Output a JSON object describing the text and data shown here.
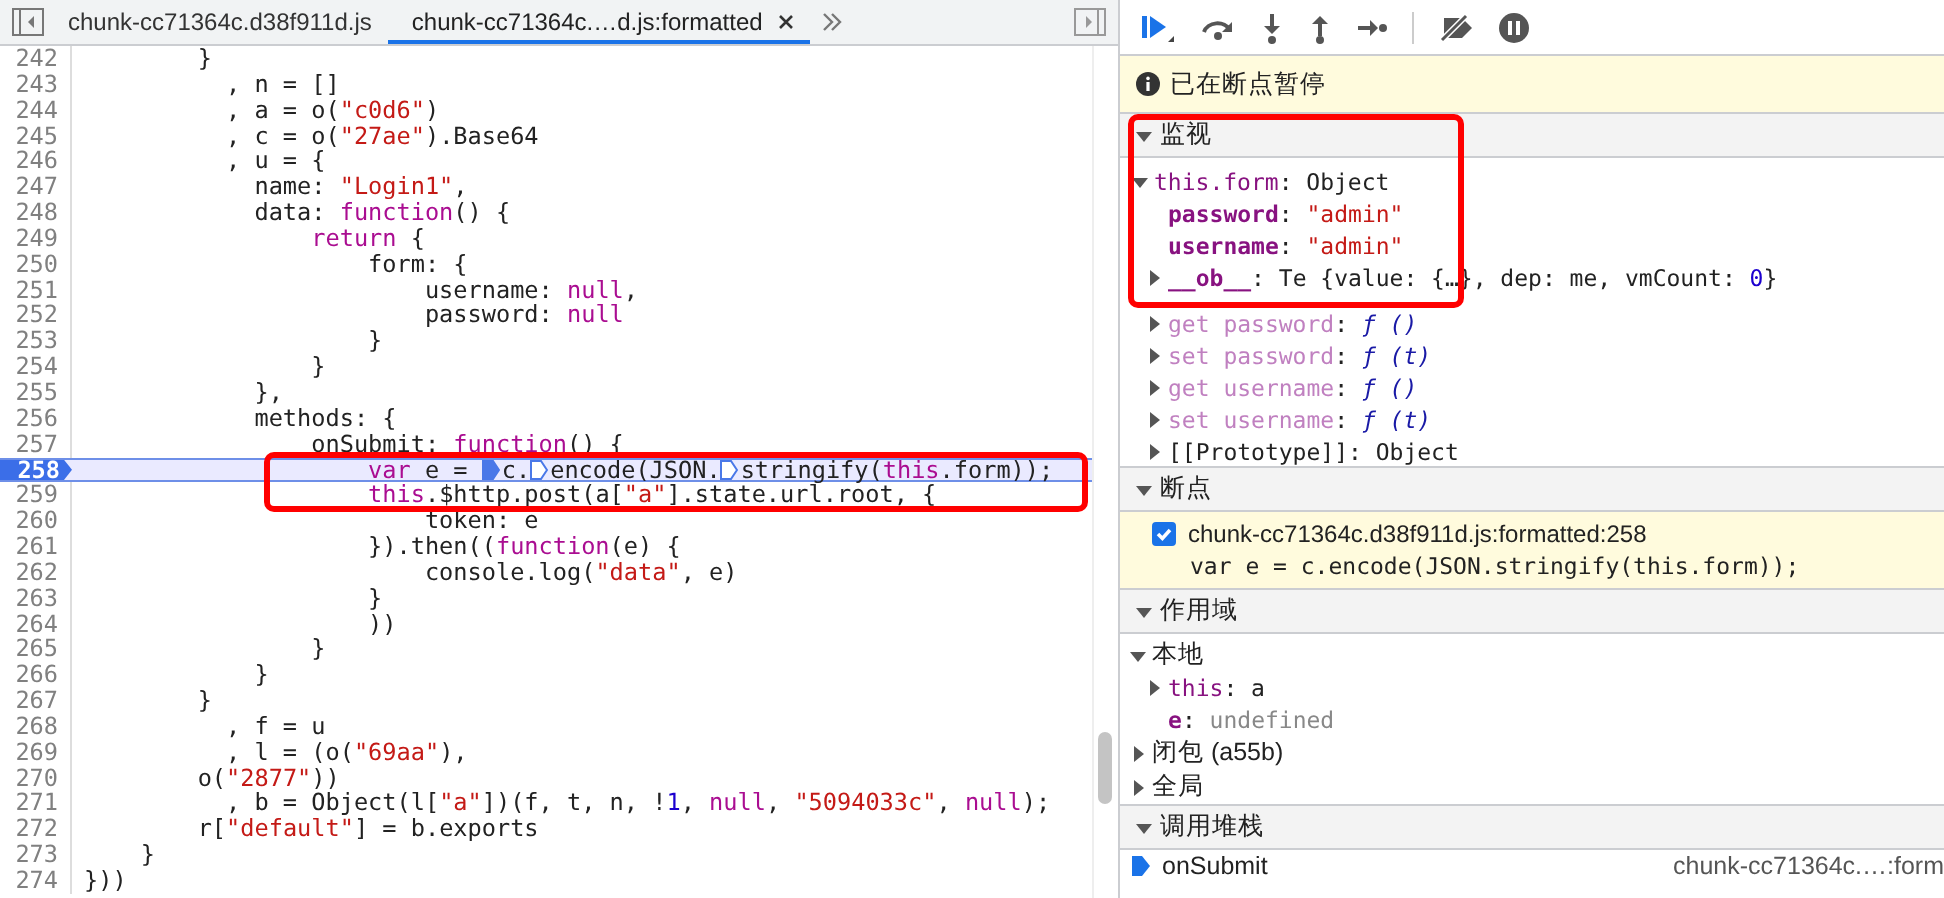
{
  "editor": {
    "tabs": [
      {
        "label": "chunk-cc71364c.d38f911d.js",
        "selected": false,
        "closable": false
      },
      {
        "label": "chunk-cc71364c.…d.js:formatted",
        "selected": true,
        "closable": true
      }
    ],
    "lines": [
      {
        "number": "242",
        "current": false,
        "tokens": [
          {
            "kind": "plain",
            "text": "        }"
          }
        ]
      },
      {
        "number": "243",
        "current": false,
        "tokens": [
          {
            "kind": "plain",
            "text": "          , n = []"
          }
        ]
      },
      {
        "number": "244",
        "current": false,
        "tokens": [
          {
            "kind": "plain",
            "text": "          , a = o("
          },
          {
            "kind": "string",
            "text": "\"c0d6\""
          },
          {
            "kind": "plain",
            "text": ")"
          }
        ]
      },
      {
        "number": "245",
        "current": false,
        "tokens": [
          {
            "kind": "plain",
            "text": "          , c = o("
          },
          {
            "kind": "string",
            "text": "\"27ae\""
          },
          {
            "kind": "plain",
            "text": ").Base64"
          }
        ]
      },
      {
        "number": "246",
        "current": false,
        "tokens": [
          {
            "kind": "plain",
            "text": "          , u = {"
          }
        ]
      },
      {
        "number": "247",
        "current": false,
        "tokens": [
          {
            "kind": "plain",
            "text": "            name: "
          },
          {
            "kind": "string",
            "text": "\"Login1\""
          },
          {
            "kind": "plain",
            "text": ","
          }
        ]
      },
      {
        "number": "248",
        "current": false,
        "tokens": [
          {
            "kind": "plain",
            "text": "            data: "
          },
          {
            "kind": "keyword",
            "text": "function"
          },
          {
            "kind": "plain",
            "text": "() {"
          }
        ]
      },
      {
        "number": "249",
        "current": false,
        "tokens": [
          {
            "kind": "keyword",
            "text": "                return"
          },
          {
            "kind": "plain",
            "text": " {"
          }
        ]
      },
      {
        "number": "250",
        "current": false,
        "tokens": [
          {
            "kind": "plain",
            "text": "                    form: {"
          }
        ]
      },
      {
        "number": "251",
        "current": false,
        "tokens": [
          {
            "kind": "plain",
            "text": "                        username: "
          },
          {
            "kind": "keyword",
            "text": "null"
          },
          {
            "kind": "plain",
            "text": ","
          }
        ]
      },
      {
        "number": "252",
        "current": false,
        "tokens": [
          {
            "kind": "plain",
            "text": "                        password: "
          },
          {
            "kind": "keyword",
            "text": "null"
          }
        ]
      },
      {
        "number": "253",
        "current": false,
        "tokens": [
          {
            "kind": "plain",
            "text": "                    }"
          }
        ]
      },
      {
        "number": "254",
        "current": false,
        "tokens": [
          {
            "kind": "plain",
            "text": "                }"
          }
        ]
      },
      {
        "number": "255",
        "current": false,
        "tokens": [
          {
            "kind": "plain",
            "text": "            },"
          }
        ]
      },
      {
        "number": "256",
        "current": false,
        "tokens": [
          {
            "kind": "plain",
            "text": "            methods: {"
          }
        ]
      },
      {
        "number": "257",
        "current": false,
        "tokens": [
          {
            "kind": "plain",
            "text": "                onSubmit: "
          },
          {
            "kind": "keyword",
            "text": "function"
          },
          {
            "kind": "plain",
            "text": "() {"
          }
        ]
      },
      {
        "number": "258",
        "current": true,
        "tokens": [
          {
            "kind": "keyword",
            "text": "                    var"
          },
          {
            "kind": "plain",
            "text": " e = "
          },
          {
            "kind": "marker"
          },
          {
            "kind": "plain",
            "text": "c."
          },
          {
            "kind": "marker"
          },
          {
            "kind": "plain",
            "text": "encode(JSON."
          },
          {
            "kind": "marker"
          },
          {
            "kind": "plain",
            "text": "stringify("
          },
          {
            "kind": "keyword",
            "text": "this"
          },
          {
            "kind": "plain",
            "text": ".form));"
          }
        ]
      },
      {
        "number": "259",
        "current": false,
        "tokens": [
          {
            "kind": "keyword",
            "text": "                    this"
          },
          {
            "kind": "plain",
            "text": ".$http.post(a["
          },
          {
            "kind": "string",
            "text": "\"a\""
          },
          {
            "kind": "plain",
            "text": "].state.url.root, {"
          }
        ]
      },
      {
        "number": "260",
        "current": false,
        "tokens": [
          {
            "kind": "plain",
            "text": "                        token: e"
          }
        ]
      },
      {
        "number": "261",
        "current": false,
        "tokens": [
          {
            "kind": "plain",
            "text": "                    }).then(("
          },
          {
            "kind": "keyword",
            "text": "function"
          },
          {
            "kind": "plain",
            "text": "(e) {"
          }
        ]
      },
      {
        "number": "262",
        "current": false,
        "tokens": [
          {
            "kind": "plain",
            "text": "                        console.log("
          },
          {
            "kind": "string",
            "text": "\"data\""
          },
          {
            "kind": "plain",
            "text": ", e)"
          }
        ]
      },
      {
        "number": "263",
        "current": false,
        "tokens": [
          {
            "kind": "plain",
            "text": "                    }"
          }
        ]
      },
      {
        "number": "264",
        "current": false,
        "tokens": [
          {
            "kind": "plain",
            "text": "                    ))"
          }
        ]
      },
      {
        "number": "265",
        "current": false,
        "tokens": [
          {
            "kind": "plain",
            "text": "                }"
          }
        ]
      },
      {
        "number": "266",
        "current": false,
        "tokens": [
          {
            "kind": "plain",
            "text": "            }"
          }
        ]
      },
      {
        "number": "267",
        "current": false,
        "tokens": [
          {
            "kind": "plain",
            "text": "        }"
          }
        ]
      },
      {
        "number": "268",
        "current": false,
        "tokens": [
          {
            "kind": "plain",
            "text": "          , f = u"
          }
        ]
      },
      {
        "number": "269",
        "current": false,
        "tokens": [
          {
            "kind": "plain",
            "text": "          , l = (o("
          },
          {
            "kind": "string",
            "text": "\"69aa\""
          },
          {
            "kind": "plain",
            "text": "),"
          }
        ]
      },
      {
        "number": "270",
        "current": false,
        "tokens": [
          {
            "kind": "plain",
            "text": "        o("
          },
          {
            "kind": "string",
            "text": "\"2877\""
          },
          {
            "kind": "plain",
            "text": "))"
          }
        ]
      },
      {
        "number": "271",
        "current": false,
        "tokens": [
          {
            "kind": "plain",
            "text": "          , b = Object(l["
          },
          {
            "kind": "string",
            "text": "\"a\""
          },
          {
            "kind": "plain",
            "text": "])(f, t, n, !"
          },
          {
            "kind": "number",
            "text": "1"
          },
          {
            "kind": "plain",
            "text": ", "
          },
          {
            "kind": "keyword",
            "text": "null"
          },
          {
            "kind": "plain",
            "text": ", "
          },
          {
            "kind": "string",
            "text": "\"5094033c\""
          },
          {
            "kind": "plain",
            "text": ", "
          },
          {
            "kind": "keyword",
            "text": "null"
          },
          {
            "kind": "plain",
            "text": ");"
          }
        ]
      },
      {
        "number": "272",
        "current": false,
        "tokens": [
          {
            "kind": "plain",
            "text": "        r["
          },
          {
            "kind": "string",
            "text": "\"default\""
          },
          {
            "kind": "plain",
            "text": "] = b.exports"
          }
        ]
      },
      {
        "number": "273",
        "current": false,
        "tokens": [
          {
            "kind": "plain",
            "text": "    }"
          }
        ]
      },
      {
        "number": "274",
        "current": false,
        "tokens": [
          {
            "kind": "plain",
            "text": "}))"
          }
        ]
      }
    ]
  },
  "debugger": {
    "paused_message": "已在断点暂停",
    "watch": {
      "title": "监视",
      "expanded": true,
      "expression": {
        "key": "this.form",
        "value": ": Object",
        "expanded": true
      },
      "properties": [
        {
          "key": "password",
          "kind": "own",
          "value": [
            {
              "kind": "plain",
              "text": ": "
            },
            {
              "kind": "string",
              "text": "\"admin\""
            }
          ]
        },
        {
          "key": "username",
          "kind": "own",
          "value": [
            {
              "kind": "plain",
              "text": ": "
            },
            {
              "kind": "string",
              "text": "\"admin\""
            }
          ]
        },
        {
          "key": "__ob__",
          "kind": "own",
          "expanded": false,
          "value": [
            {
              "kind": "plain",
              "text": ": Te {value: {…}, dep: me, vmCount: "
            },
            {
              "kind": "number",
              "text": "0"
            },
            {
              "kind": "plain",
              "text": "}"
            }
          ]
        },
        {
          "key": "get password",
          "kind": "accessor",
          "expanded": false,
          "value": [
            {
              "kind": "plain",
              "text": ": "
            },
            {
              "kind": "fn",
              "text": "ƒ ()"
            }
          ]
        },
        {
          "key": "set password",
          "kind": "accessor",
          "expanded": false,
          "value": [
            {
              "kind": "plain",
              "text": ": "
            },
            {
              "kind": "fn",
              "text": "ƒ (t)"
            }
          ]
        },
        {
          "key": "get username",
          "kind": "accessor",
          "expanded": false,
          "value": [
            {
              "kind": "plain",
              "text": ": "
            },
            {
              "kind": "fn",
              "text": "ƒ ()"
            }
          ]
        },
        {
          "key": "set username",
          "kind": "accessor",
          "expanded": false,
          "value": [
            {
              "kind": "plain",
              "text": ": "
            },
            {
              "kind": "fn",
              "text": "ƒ (t)"
            }
          ]
        },
        {
          "key": "[[Prototype]]",
          "kind": "internal",
          "expanded": false,
          "value": [
            {
              "kind": "plain",
              "text": ": Object"
            }
          ]
        }
      ]
    },
    "breakpoints": {
      "title": "断点",
      "expanded": true,
      "items": [
        {
          "location": "chunk-cc71364c.d38f911d.js:formatted:258",
          "code": "var e = c.encode(JSON.stringify(this.form));",
          "checked": true
        }
      ]
    },
    "scope": {
      "title": "作用域",
      "expanded": true,
      "groups": [
        {
          "label": "本地",
          "expanded": true,
          "children": [
            {
              "key": "this",
              "kind": "plain",
              "expanded": false,
              "value": [
                {
                  "kind": "plain",
                  "text": ": a"
                }
              ]
            },
            {
              "key": "e",
              "kind": "own",
              "value": [
                {
                  "kind": "plain",
                  "text": ": "
                },
                {
                  "kind": "undefined",
                  "text": "undefined"
                }
              ]
            }
          ]
        },
        {
          "label": "闭包 (a55b)",
          "expanded": false
        },
        {
          "label": "全局",
          "expanded": false
        }
      ]
    },
    "call_stack": {
      "title": "调用堆栈",
      "expanded": true,
      "frames": [
        {
          "function": "onSubmit",
          "location": "chunk-cc71364c.…:form",
          "selected": true
        }
      ]
    }
  }
}
